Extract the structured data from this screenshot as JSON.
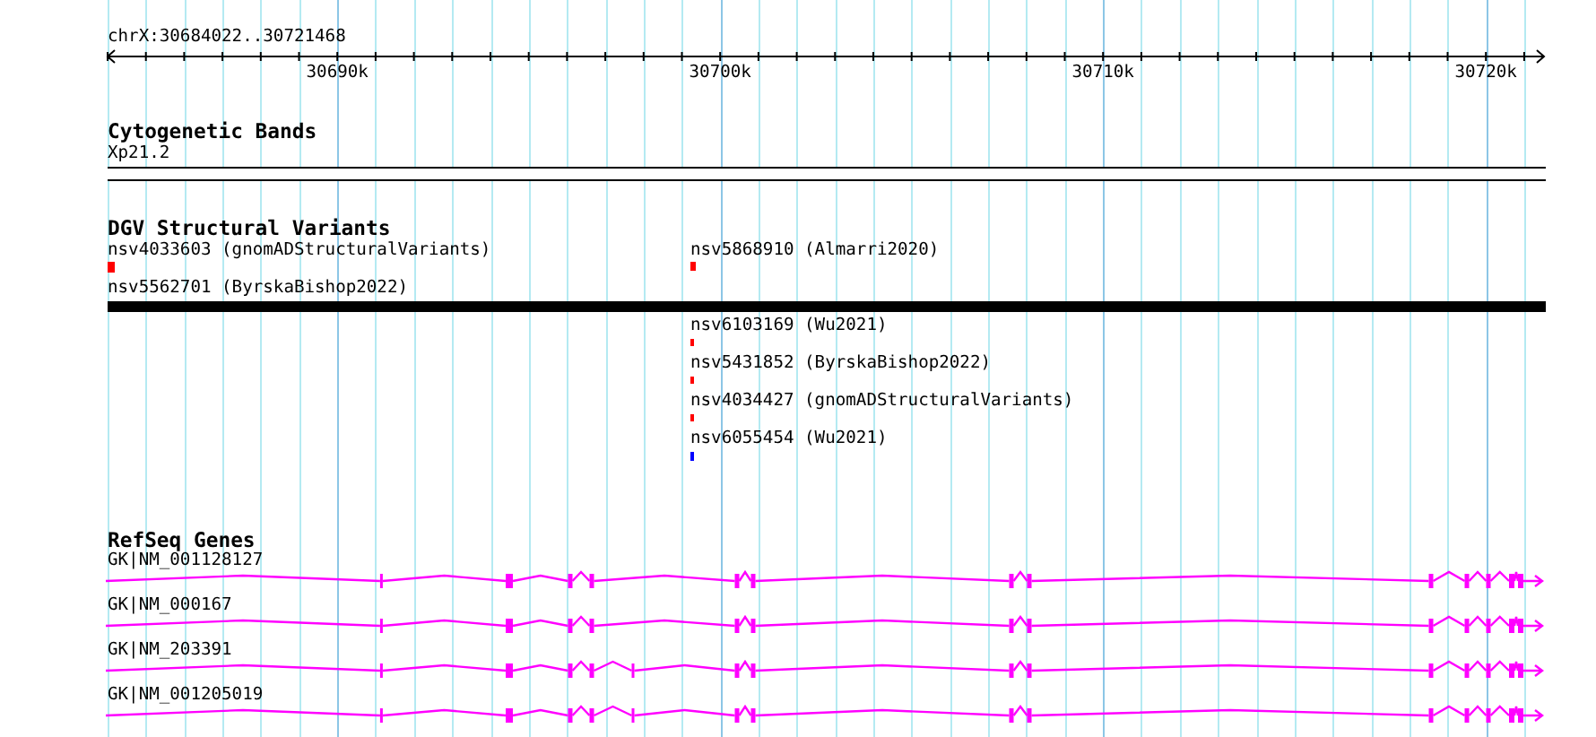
{
  "ruler": {
    "location": "chrX:30684022..30721468",
    "ticks": [
      "30690k",
      "30700k",
      "30710k",
      "30720k"
    ]
  },
  "tracks": [
    {
      "kind": "cytoband",
      "title": "Cytogenetic Bands",
      "bands": [
        {
          "name": "Xp21.2"
        }
      ]
    },
    {
      "kind": "variants",
      "title": "DGV Structural Variants",
      "items": [
        {
          "label": "nsv4033603 (gnomADStructuralVariants)",
          "color": "#ff0000"
        },
        {
          "label": "nsv5868910 (Almarri2020)",
          "color": "#ff0000"
        },
        {
          "label": "nsv5562701 (ByrskaBishop2022)",
          "color": "#000000"
        },
        {
          "label": "nsv6103169 (Wu2021)",
          "color": "#ff0000"
        },
        {
          "label": "nsv5431852 (ByrskaBishop2022)",
          "color": "#ff0000"
        },
        {
          "label": "nsv4034427 (gnomADStructuralVariants)",
          "color": "#ff0000"
        },
        {
          "label": "nsv6055454 (Wu2021)",
          "color": "#0000ff"
        }
      ]
    },
    {
      "kind": "genes",
      "title": "RefSeq Genes",
      "items": [
        {
          "name": "GK|NM_001128127"
        },
        {
          "name": "GK|NM_000167"
        },
        {
          "name": "GK|NM_203391"
        },
        {
          "name": "GK|NM_001205019"
        }
      ]
    }
  ]
}
